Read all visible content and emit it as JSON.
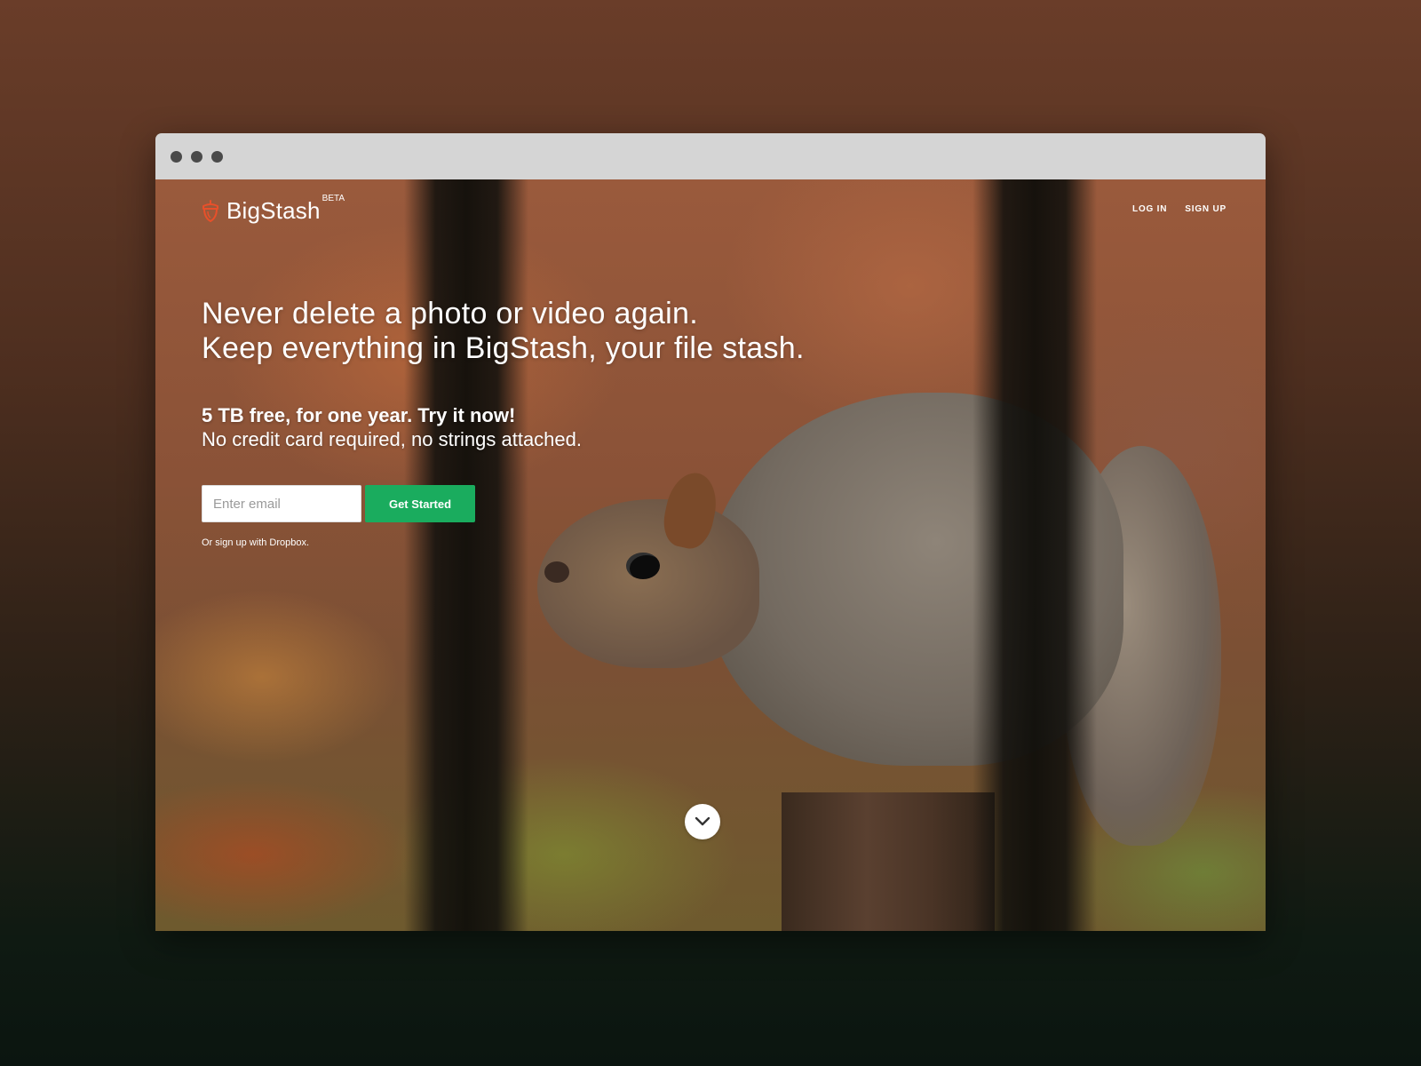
{
  "brand": {
    "name": "BigStash",
    "badge": "BETA",
    "logo_icon": "acorn-icon",
    "accent_color": "#e8502a"
  },
  "nav": {
    "login_label": "LOG IN",
    "signup_label": "SIGN UP"
  },
  "hero": {
    "headline_line1": "Never delete a photo or video again.",
    "headline_line2": "Keep everything in BigStash, your file stash.",
    "offer_bold": "5 TB free, for one year. Try it now!",
    "offer_sub": "No credit card required, no strings attached."
  },
  "signup": {
    "email_placeholder": "Enter email",
    "email_value": "",
    "button_label": "Get Started",
    "button_color": "#1aac5e",
    "alt_prefix": "Or sign up with ",
    "alt_link": "Dropbox",
    "alt_suffix": "."
  },
  "scroll": {
    "icon": "chevron-down-icon"
  }
}
